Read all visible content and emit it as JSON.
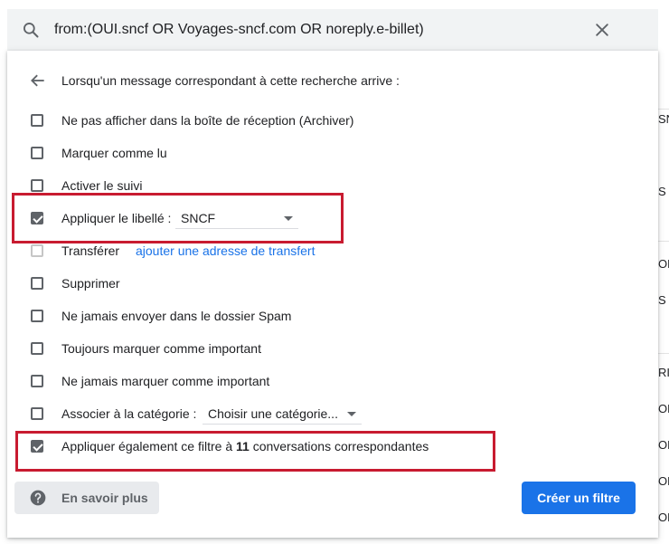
{
  "search": {
    "query": "from:(OUI.sncf OR Voyages-sncf.com OR noreply.e-billet)"
  },
  "filter_panel": {
    "header": "Lorsqu'un message correspondant à cette recherche arrive :",
    "options": {
      "skip_inbox": {
        "label": "Ne pas afficher dans la boîte de réception (Archiver)",
        "checked": false
      },
      "mark_read": {
        "label": "Marquer comme lu",
        "checked": false
      },
      "star": {
        "label": "Activer le suivi",
        "checked": false
      },
      "apply_label": {
        "label": "Appliquer le libellé :",
        "checked": true,
        "select_value": "SNCF"
      },
      "forward": {
        "label": "Transférer",
        "checked": false,
        "link": "ajouter une adresse de transfert"
      },
      "delete": {
        "label": "Supprimer",
        "checked": false
      },
      "never_spam": {
        "label": "Ne jamais envoyer dans le dossier Spam",
        "checked": false
      },
      "always_important": {
        "label": "Toujours marquer comme important",
        "checked": false
      },
      "never_important": {
        "label": "Ne jamais marquer comme important",
        "checked": false
      },
      "category": {
        "label": "Associer à la catégorie :",
        "checked": false,
        "select_value": "Choisir une catégorie..."
      },
      "apply_existing": {
        "label_prefix": "Appliquer également ce filtre à ",
        "count": "11",
        "label_suffix": " conversations correspondantes",
        "checked": true
      }
    },
    "help_button": "En savoir plus",
    "create_button": "Créer un filtre"
  },
  "background_list_fragments": [
    "SN",
    "S",
    "OB",
    "S",
    "RIS",
    "OB",
    "OB",
    "OB",
    "OB"
  ],
  "colors": {
    "accent": "#1a73e8",
    "highlight_box": "#c81b30",
    "search_bg": "#f1f3f4",
    "checkbox": "#5f6368"
  },
  "icons": [
    "search-icon",
    "close-icon",
    "arrow-back-icon",
    "help-icon"
  ]
}
